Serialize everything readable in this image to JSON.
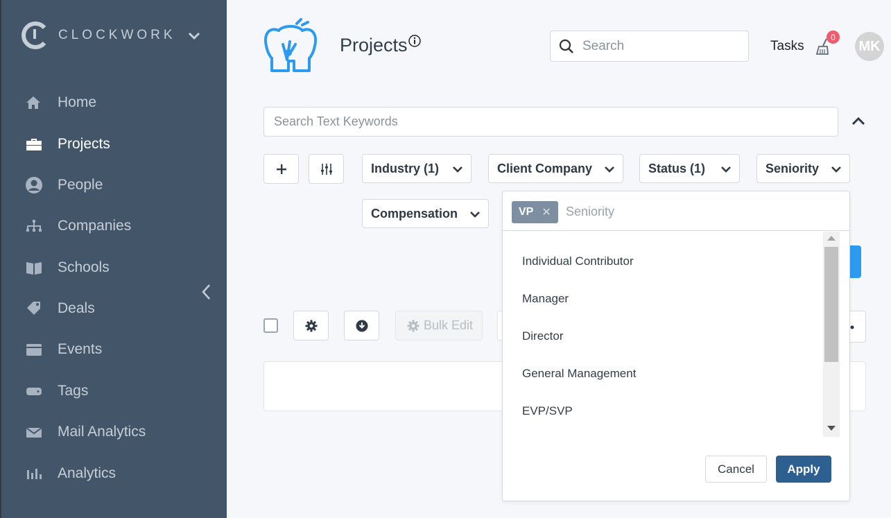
{
  "app": {
    "brand": "CLOCKWORK"
  },
  "sidebar": {
    "items": [
      {
        "label": "Home",
        "icon": "home-icon"
      },
      {
        "label": "Projects",
        "icon": "briefcase-icon",
        "active": true
      },
      {
        "label": "People",
        "icon": "person-icon"
      },
      {
        "label": "Companies",
        "icon": "org-chart-icon"
      },
      {
        "label": "Schools",
        "icon": "book-icon"
      },
      {
        "label": "Deals",
        "icon": "tags-icon"
      },
      {
        "label": "Events",
        "icon": "calendar-icon"
      },
      {
        "label": "Tags",
        "icon": "tag-icon"
      },
      {
        "label": "Mail Analytics",
        "icon": "envelope-icon"
      },
      {
        "label": "Analytics",
        "icon": "bar-chart-icon"
      }
    ]
  },
  "header": {
    "title": "Projects",
    "search_placeholder": "Search",
    "tasks_label": "Tasks",
    "tasks_count": "0",
    "avatar_initials": "MK"
  },
  "filters": {
    "keyword_placeholder": "Search Text Keywords",
    "industry": "Industry (1)",
    "client_company": "Client Company",
    "status": "Status (1)",
    "seniority": "Seniority",
    "compensation": "Compensation"
  },
  "toolbar": {
    "bulk_edit": "Bulk Edit"
  },
  "seniority_panel": {
    "selected_chip": "VP",
    "placeholder": "Seniority",
    "options": [
      "Individual Contributor",
      "Manager",
      "Director",
      "General Management",
      "EVP/SVP"
    ],
    "cancel": "Cancel",
    "apply": "Apply"
  },
  "colors": {
    "sidebar": "#435569",
    "accent": "#2d5f91",
    "badge": "#ef5c6e",
    "logo": "#2c9af0"
  }
}
